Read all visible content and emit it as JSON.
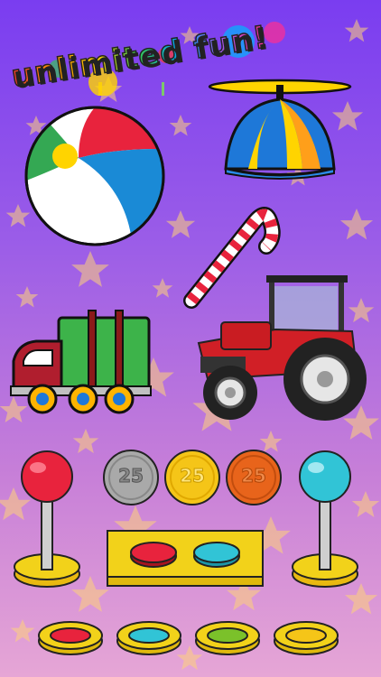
{
  "title": "unlimited fun!",
  "toys": [
    {
      "name": "beach-ball"
    },
    {
      "name": "propeller-hat"
    },
    {
      "name": "candy-cane"
    },
    {
      "name": "truck"
    },
    {
      "name": "tractor"
    }
  ],
  "coins": [
    {
      "label": "25",
      "color": "#a9a9a9"
    },
    {
      "label": "25",
      "color": "#f5c518"
    },
    {
      "label": "25",
      "color": "#e8641b"
    }
  ],
  "joysticks": [
    {
      "color": "#e8233d"
    },
    {
      "color": "#31c4d6"
    }
  ],
  "panel_buttons": [
    {
      "color": "#e8233d"
    },
    {
      "color": "#31c4d6"
    }
  ],
  "bottom_buttons": [
    {
      "color": "#e8233d"
    },
    {
      "color": "#31c4d6"
    },
    {
      "color": "#7bc12a"
    },
    {
      "color": "#f5c518"
    }
  ],
  "colors": {
    "background_top": "#7a3df0",
    "background_bottom": "#e6a6d6",
    "button_base": "#f2d21a"
  }
}
